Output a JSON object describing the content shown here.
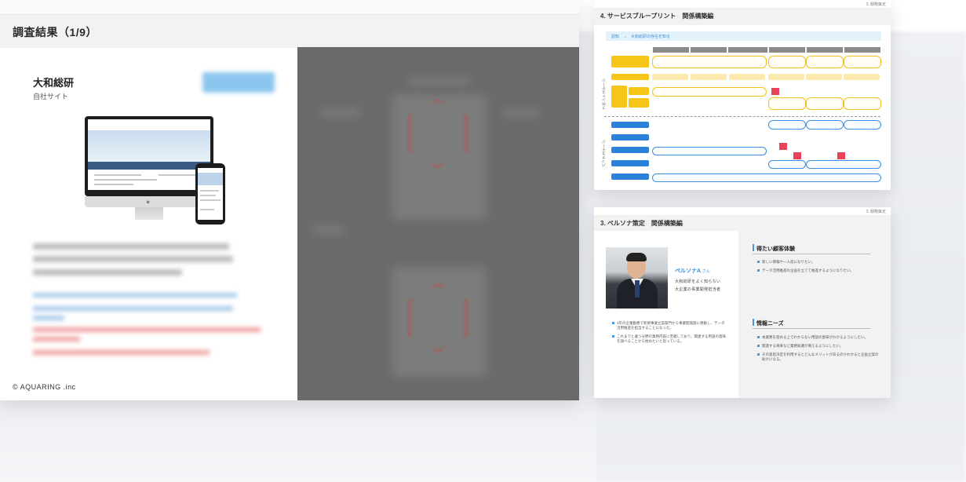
{
  "slide1": {
    "title": "調査結果（1/9）",
    "company_name": "大和総研",
    "company_sub": "自社サイト",
    "logo_text": "© AQUARING .inc"
  },
  "slide2": {
    "page_tag": "3. 戦略策定",
    "title": "4. サービスブループリント　関係構築編",
    "phase_bar": "認知　→　大和総研の存在を知る",
    "lane_front": "フロントステージ",
    "lane_back": "バックステージ"
  },
  "slide3": {
    "page_tag": "3. 戦略策定",
    "title": "3. ペルソナ策定　関係構築編",
    "persona_name": "ペルソナA",
    "persona_suffix": "さん",
    "persona_desc_1": "大和総研をよく知らない",
    "persona_desc_2": "大企業の事業開発担当者",
    "section_experience": "得たい顧客体験",
    "section_info": "情報ニーズ",
    "experience_items": [
      "新しい情報や一人前になりたい。",
      "データ活用推進の企画を立てて推進するようになりたい。"
    ],
    "info_items": [
      "本業務を進める上でわからない用語の意味がわかるようにしたい。",
      "関連する将来など業務知識が増えるようにしたい。",
      "その意思決定を利用するとどんなメリットがあるのかわかると企画立案の助けになる。"
    ],
    "left_items": [
      "4年の企業勤務で新規事業立案部門から事業開発部に異動し、データ活用推進を担当することになった。",
      "これまでと違う分野の業務内容に苦戦しており、関連する用語の意味を調べることから始めたいと思っている。"
    ]
  },
  "colors": {
    "accent_blue": "#2d8ee0",
    "yellow": "#f7c41a",
    "blue": "#2b82d9",
    "pink": "#e9435c"
  }
}
